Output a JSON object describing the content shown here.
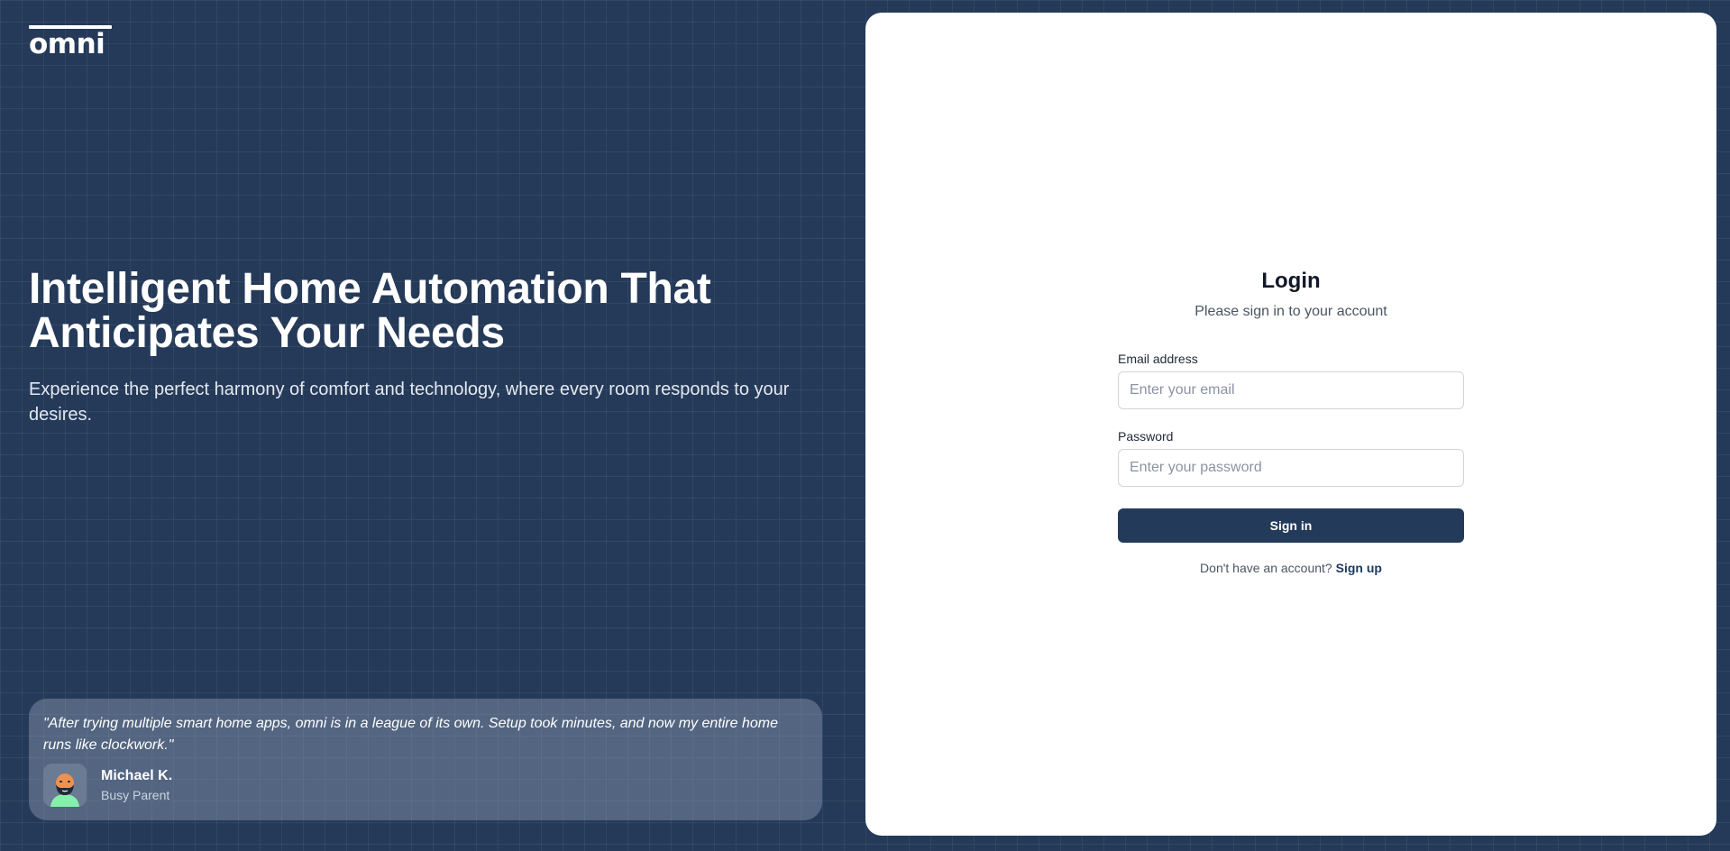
{
  "brand": {
    "logo_text": "omni"
  },
  "hero": {
    "headline": "Intelligent Home Automation That Anticipates Your Needs",
    "subheadline": "Experience the perfect harmony of comfort and technology, where every room responds to your desires."
  },
  "testimonial": {
    "quote": "\"After trying multiple smart home apps, omni is in a league of its own. Setup took minutes, and now my entire home runs like clockwork.\"",
    "author_name": "Michael K.",
    "author_role": "Busy Parent",
    "avatar_icon": "person-avatar-icon"
  },
  "login": {
    "title": "Login",
    "subtitle": "Please sign in to your account",
    "email_label": "Email address",
    "email_placeholder": "Enter your email",
    "email_value": "",
    "password_label": "Password",
    "password_placeholder": "Enter your password",
    "password_value": "",
    "signin_label": "Sign in",
    "no_account_text": "Don't have an account?",
    "signup_label": "Sign up"
  },
  "colors": {
    "background": "#253a59",
    "primary_button": "#233a5a",
    "card": "#ffffff"
  }
}
